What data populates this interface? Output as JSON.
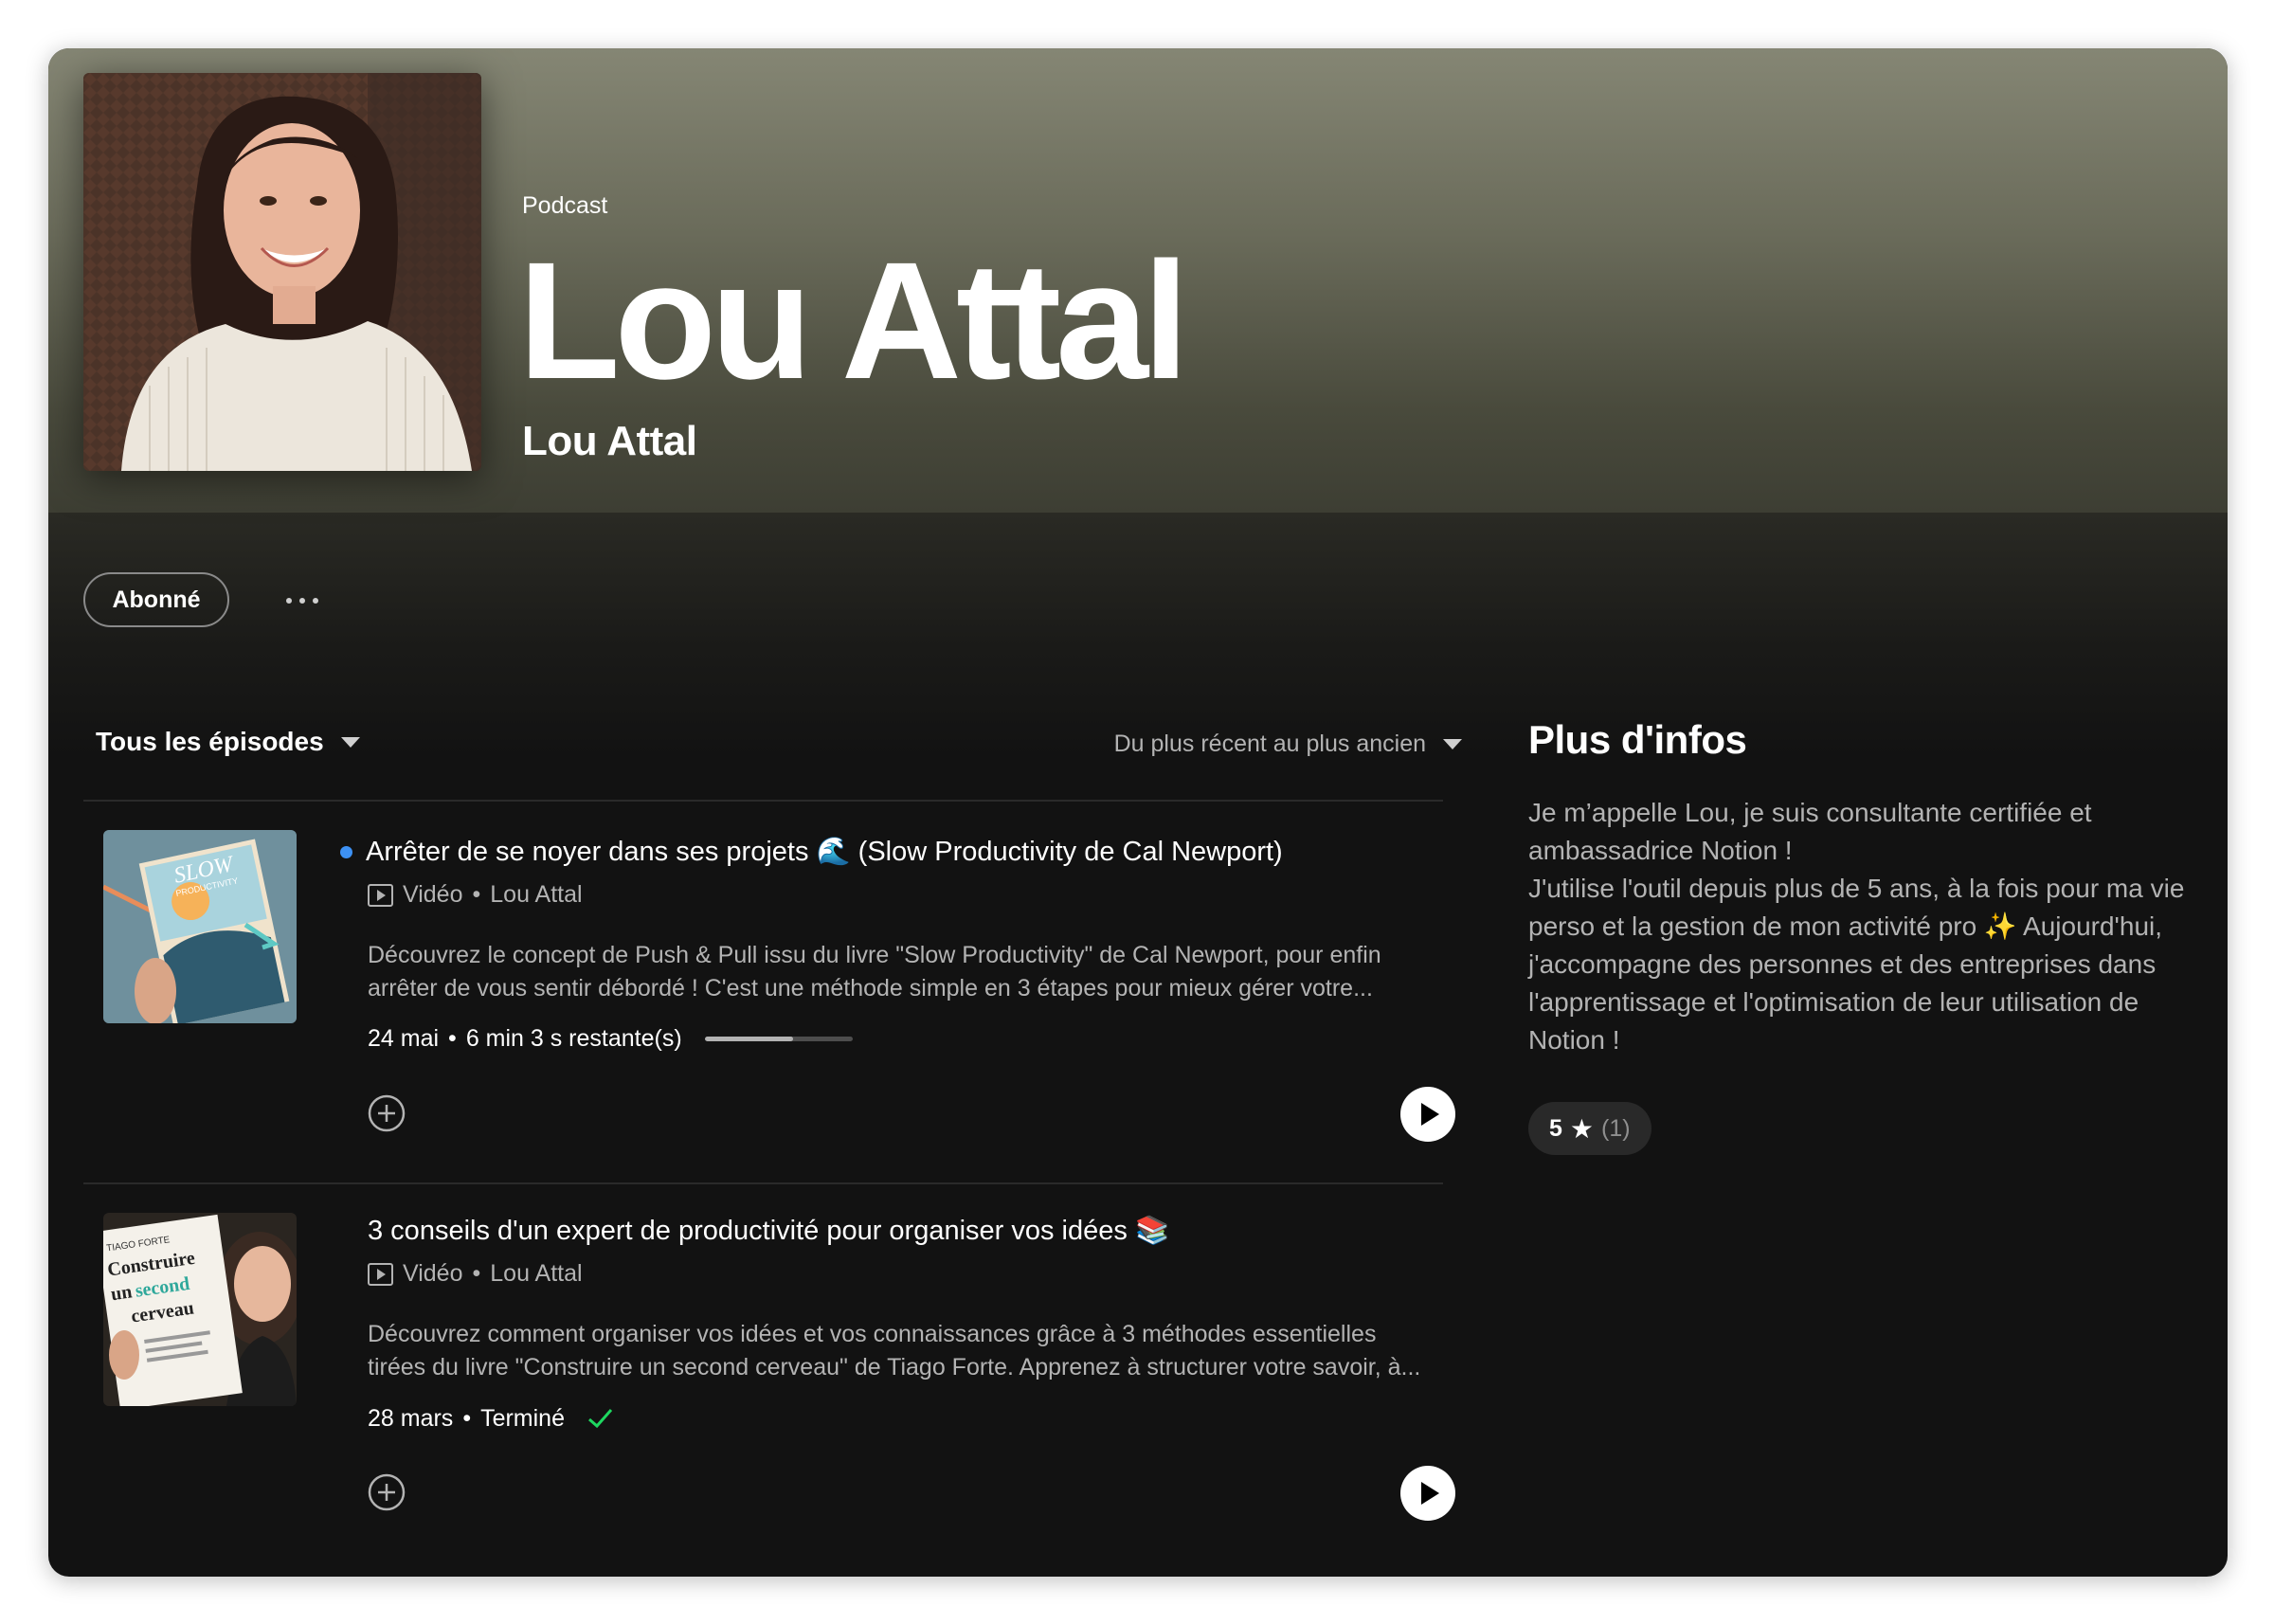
{
  "header": {
    "kind_label": "Podcast",
    "title": "Lou Attal",
    "author": "Lou Attal"
  },
  "actions": {
    "follow_label": "Abonné",
    "more_icon": "more-horizontal-icon"
  },
  "episodes_list": {
    "filter_label": "Tous les épisodes",
    "sort_label": "Du plus récent au plus ancien"
  },
  "episodes": [
    {
      "title": "Arrêter de se noyer dans ses projets 🌊 (Slow Productivity de Cal Newport)",
      "is_new": true,
      "media_type": "Vidéo",
      "author": "Lou Attal",
      "description": "Découvrez le concept de Push & Pull issu du livre \"Slow Productivity\" de Cal Newport, pour enfin\narrêter de vous sentir débordé ! C'est une méthode simple en 3 étapes pour mieux gérer votre...",
      "date": "24 mai",
      "status": "6 min 3 s restante(s)",
      "progress": 0.6
    },
    {
      "title": "3 conseils d'un expert de productivité pour organiser vos idées 📚",
      "is_new": false,
      "media_type": "Vidéo",
      "author": "Lou Attal",
      "description": "Découvrez comment organiser vos idées et vos connaissances grâce à 3 méthodes essentielles\ntirées du livre \"Construire un second cerveau\" de Tiago Forte. Apprenez à structurer votre savoir, à...",
      "date": "28 mars",
      "status": "Terminé",
      "completed": true,
      "thumb_text": {
        "author": "TIAGO FORTE",
        "line1": "Construire",
        "line2": "un",
        "line3": "second",
        "line4": "cerveau"
      }
    }
  ],
  "episode_thumb_1": {
    "book_title": "SLOW",
    "book_subtitle": "PRODUCTIVITY"
  },
  "about": {
    "heading": "Plus d'infos",
    "text": "Je m’appelle Lou, je suis consultante certifiée et\nambassadrice Notion !\nJ'utilise l'outil depuis plus de 5 ans, à la fois pour ma vie\nperso et la gestion de mon activité pro ✨ Aujourd'hui,\nj'accompagne des personnes et des entreprises dans\nl'apprentissage et l'optimisation de leur utilisation de\nNotion !",
    "rating_score": "5",
    "rating_count": "(1)"
  },
  "colors": {
    "hero_top": "#858674",
    "background": "#121212",
    "new_dot": "#3d91f4",
    "check": "#1ed760"
  }
}
